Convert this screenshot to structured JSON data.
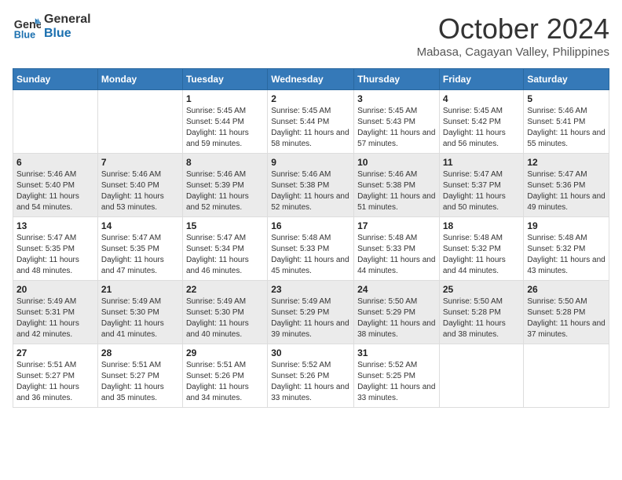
{
  "header": {
    "logo_line1": "General",
    "logo_line2": "Blue",
    "month": "October 2024",
    "location": "Mabasa, Cagayan Valley, Philippines"
  },
  "weekdays": [
    "Sunday",
    "Monday",
    "Tuesday",
    "Wednesday",
    "Thursday",
    "Friday",
    "Saturday"
  ],
  "weeks": [
    [
      {
        "day": "",
        "info": ""
      },
      {
        "day": "",
        "info": ""
      },
      {
        "day": "1",
        "info": "Sunrise: 5:45 AM\nSunset: 5:44 PM\nDaylight: 11 hours and 59 minutes."
      },
      {
        "day": "2",
        "info": "Sunrise: 5:45 AM\nSunset: 5:44 PM\nDaylight: 11 hours and 58 minutes."
      },
      {
        "day": "3",
        "info": "Sunrise: 5:45 AM\nSunset: 5:43 PM\nDaylight: 11 hours and 57 minutes."
      },
      {
        "day": "4",
        "info": "Sunrise: 5:45 AM\nSunset: 5:42 PM\nDaylight: 11 hours and 56 minutes."
      },
      {
        "day": "5",
        "info": "Sunrise: 5:46 AM\nSunset: 5:41 PM\nDaylight: 11 hours and 55 minutes."
      }
    ],
    [
      {
        "day": "6",
        "info": "Sunrise: 5:46 AM\nSunset: 5:40 PM\nDaylight: 11 hours and 54 minutes."
      },
      {
        "day": "7",
        "info": "Sunrise: 5:46 AM\nSunset: 5:40 PM\nDaylight: 11 hours and 53 minutes."
      },
      {
        "day": "8",
        "info": "Sunrise: 5:46 AM\nSunset: 5:39 PM\nDaylight: 11 hours and 52 minutes."
      },
      {
        "day": "9",
        "info": "Sunrise: 5:46 AM\nSunset: 5:38 PM\nDaylight: 11 hours and 52 minutes."
      },
      {
        "day": "10",
        "info": "Sunrise: 5:46 AM\nSunset: 5:38 PM\nDaylight: 11 hours and 51 minutes."
      },
      {
        "day": "11",
        "info": "Sunrise: 5:47 AM\nSunset: 5:37 PM\nDaylight: 11 hours and 50 minutes."
      },
      {
        "day": "12",
        "info": "Sunrise: 5:47 AM\nSunset: 5:36 PM\nDaylight: 11 hours and 49 minutes."
      }
    ],
    [
      {
        "day": "13",
        "info": "Sunrise: 5:47 AM\nSunset: 5:35 PM\nDaylight: 11 hours and 48 minutes."
      },
      {
        "day": "14",
        "info": "Sunrise: 5:47 AM\nSunset: 5:35 PM\nDaylight: 11 hours and 47 minutes."
      },
      {
        "day": "15",
        "info": "Sunrise: 5:47 AM\nSunset: 5:34 PM\nDaylight: 11 hours and 46 minutes."
      },
      {
        "day": "16",
        "info": "Sunrise: 5:48 AM\nSunset: 5:33 PM\nDaylight: 11 hours and 45 minutes."
      },
      {
        "day": "17",
        "info": "Sunrise: 5:48 AM\nSunset: 5:33 PM\nDaylight: 11 hours and 44 minutes."
      },
      {
        "day": "18",
        "info": "Sunrise: 5:48 AM\nSunset: 5:32 PM\nDaylight: 11 hours and 44 minutes."
      },
      {
        "day": "19",
        "info": "Sunrise: 5:48 AM\nSunset: 5:32 PM\nDaylight: 11 hours and 43 minutes."
      }
    ],
    [
      {
        "day": "20",
        "info": "Sunrise: 5:49 AM\nSunset: 5:31 PM\nDaylight: 11 hours and 42 minutes."
      },
      {
        "day": "21",
        "info": "Sunrise: 5:49 AM\nSunset: 5:30 PM\nDaylight: 11 hours and 41 minutes."
      },
      {
        "day": "22",
        "info": "Sunrise: 5:49 AM\nSunset: 5:30 PM\nDaylight: 11 hours and 40 minutes."
      },
      {
        "day": "23",
        "info": "Sunrise: 5:49 AM\nSunset: 5:29 PM\nDaylight: 11 hours and 39 minutes."
      },
      {
        "day": "24",
        "info": "Sunrise: 5:50 AM\nSunset: 5:29 PM\nDaylight: 11 hours and 38 minutes."
      },
      {
        "day": "25",
        "info": "Sunrise: 5:50 AM\nSunset: 5:28 PM\nDaylight: 11 hours and 38 minutes."
      },
      {
        "day": "26",
        "info": "Sunrise: 5:50 AM\nSunset: 5:28 PM\nDaylight: 11 hours and 37 minutes."
      }
    ],
    [
      {
        "day": "27",
        "info": "Sunrise: 5:51 AM\nSunset: 5:27 PM\nDaylight: 11 hours and 36 minutes."
      },
      {
        "day": "28",
        "info": "Sunrise: 5:51 AM\nSunset: 5:27 PM\nDaylight: 11 hours and 35 minutes."
      },
      {
        "day": "29",
        "info": "Sunrise: 5:51 AM\nSunset: 5:26 PM\nDaylight: 11 hours and 34 minutes."
      },
      {
        "day": "30",
        "info": "Sunrise: 5:52 AM\nSunset: 5:26 PM\nDaylight: 11 hours and 33 minutes."
      },
      {
        "day": "31",
        "info": "Sunrise: 5:52 AM\nSunset: 5:25 PM\nDaylight: 11 hours and 33 minutes."
      },
      {
        "day": "",
        "info": ""
      },
      {
        "day": "",
        "info": ""
      }
    ]
  ]
}
